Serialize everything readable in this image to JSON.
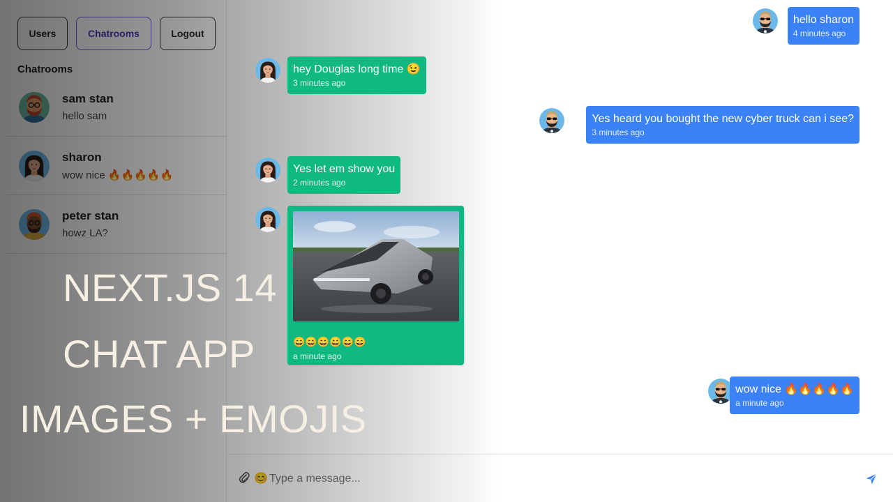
{
  "nav": {
    "users": "Users",
    "chatrooms": "Chatrooms",
    "logout": "Logout"
  },
  "sidebar": {
    "title": "Chatrooms",
    "rooms": [
      {
        "name": "sam stan",
        "preview": "hello sam"
      },
      {
        "name": "sharon",
        "preview": "wow nice 🔥🔥🔥🔥🔥"
      },
      {
        "name": "peter stan",
        "preview": "howz LA?"
      }
    ]
  },
  "promo": {
    "line1": "NEXT.JS 14",
    "line2": "CHAT APP",
    "line3": "IMAGES + EMOJIS"
  },
  "messages": [
    {
      "text": "hello sharon",
      "time": "4 minutes ago",
      "sender": "douglas"
    },
    {
      "text": "hey Douglas long time 😉",
      "time": "3 minutes ago",
      "sender": "sharon"
    },
    {
      "text": "Yes heard you bought the new cyber truck can i see?",
      "time": "3 minutes ago",
      "sender": "douglas"
    },
    {
      "text": "Yes let em show you",
      "time": "2 minutes ago",
      "sender": "sharon"
    },
    {
      "text": "😄😄😄😄😄😄",
      "time": "a minute ago",
      "sender": "sharon",
      "image": "cybertruck-photo"
    },
    {
      "text": "wow nice 🔥🔥🔥🔥🔥",
      "time": "a minute ago",
      "sender": "douglas"
    }
  ],
  "composer": {
    "placeholder": "Type a message...",
    "attach_icon": "paperclip-icon",
    "emoji_icon": "emoji-smile-icon",
    "send_icon": "send-icon"
  },
  "colors": {
    "sent": "#3b82f6",
    "received": "#10b981",
    "accent": "#4b3bc4"
  }
}
